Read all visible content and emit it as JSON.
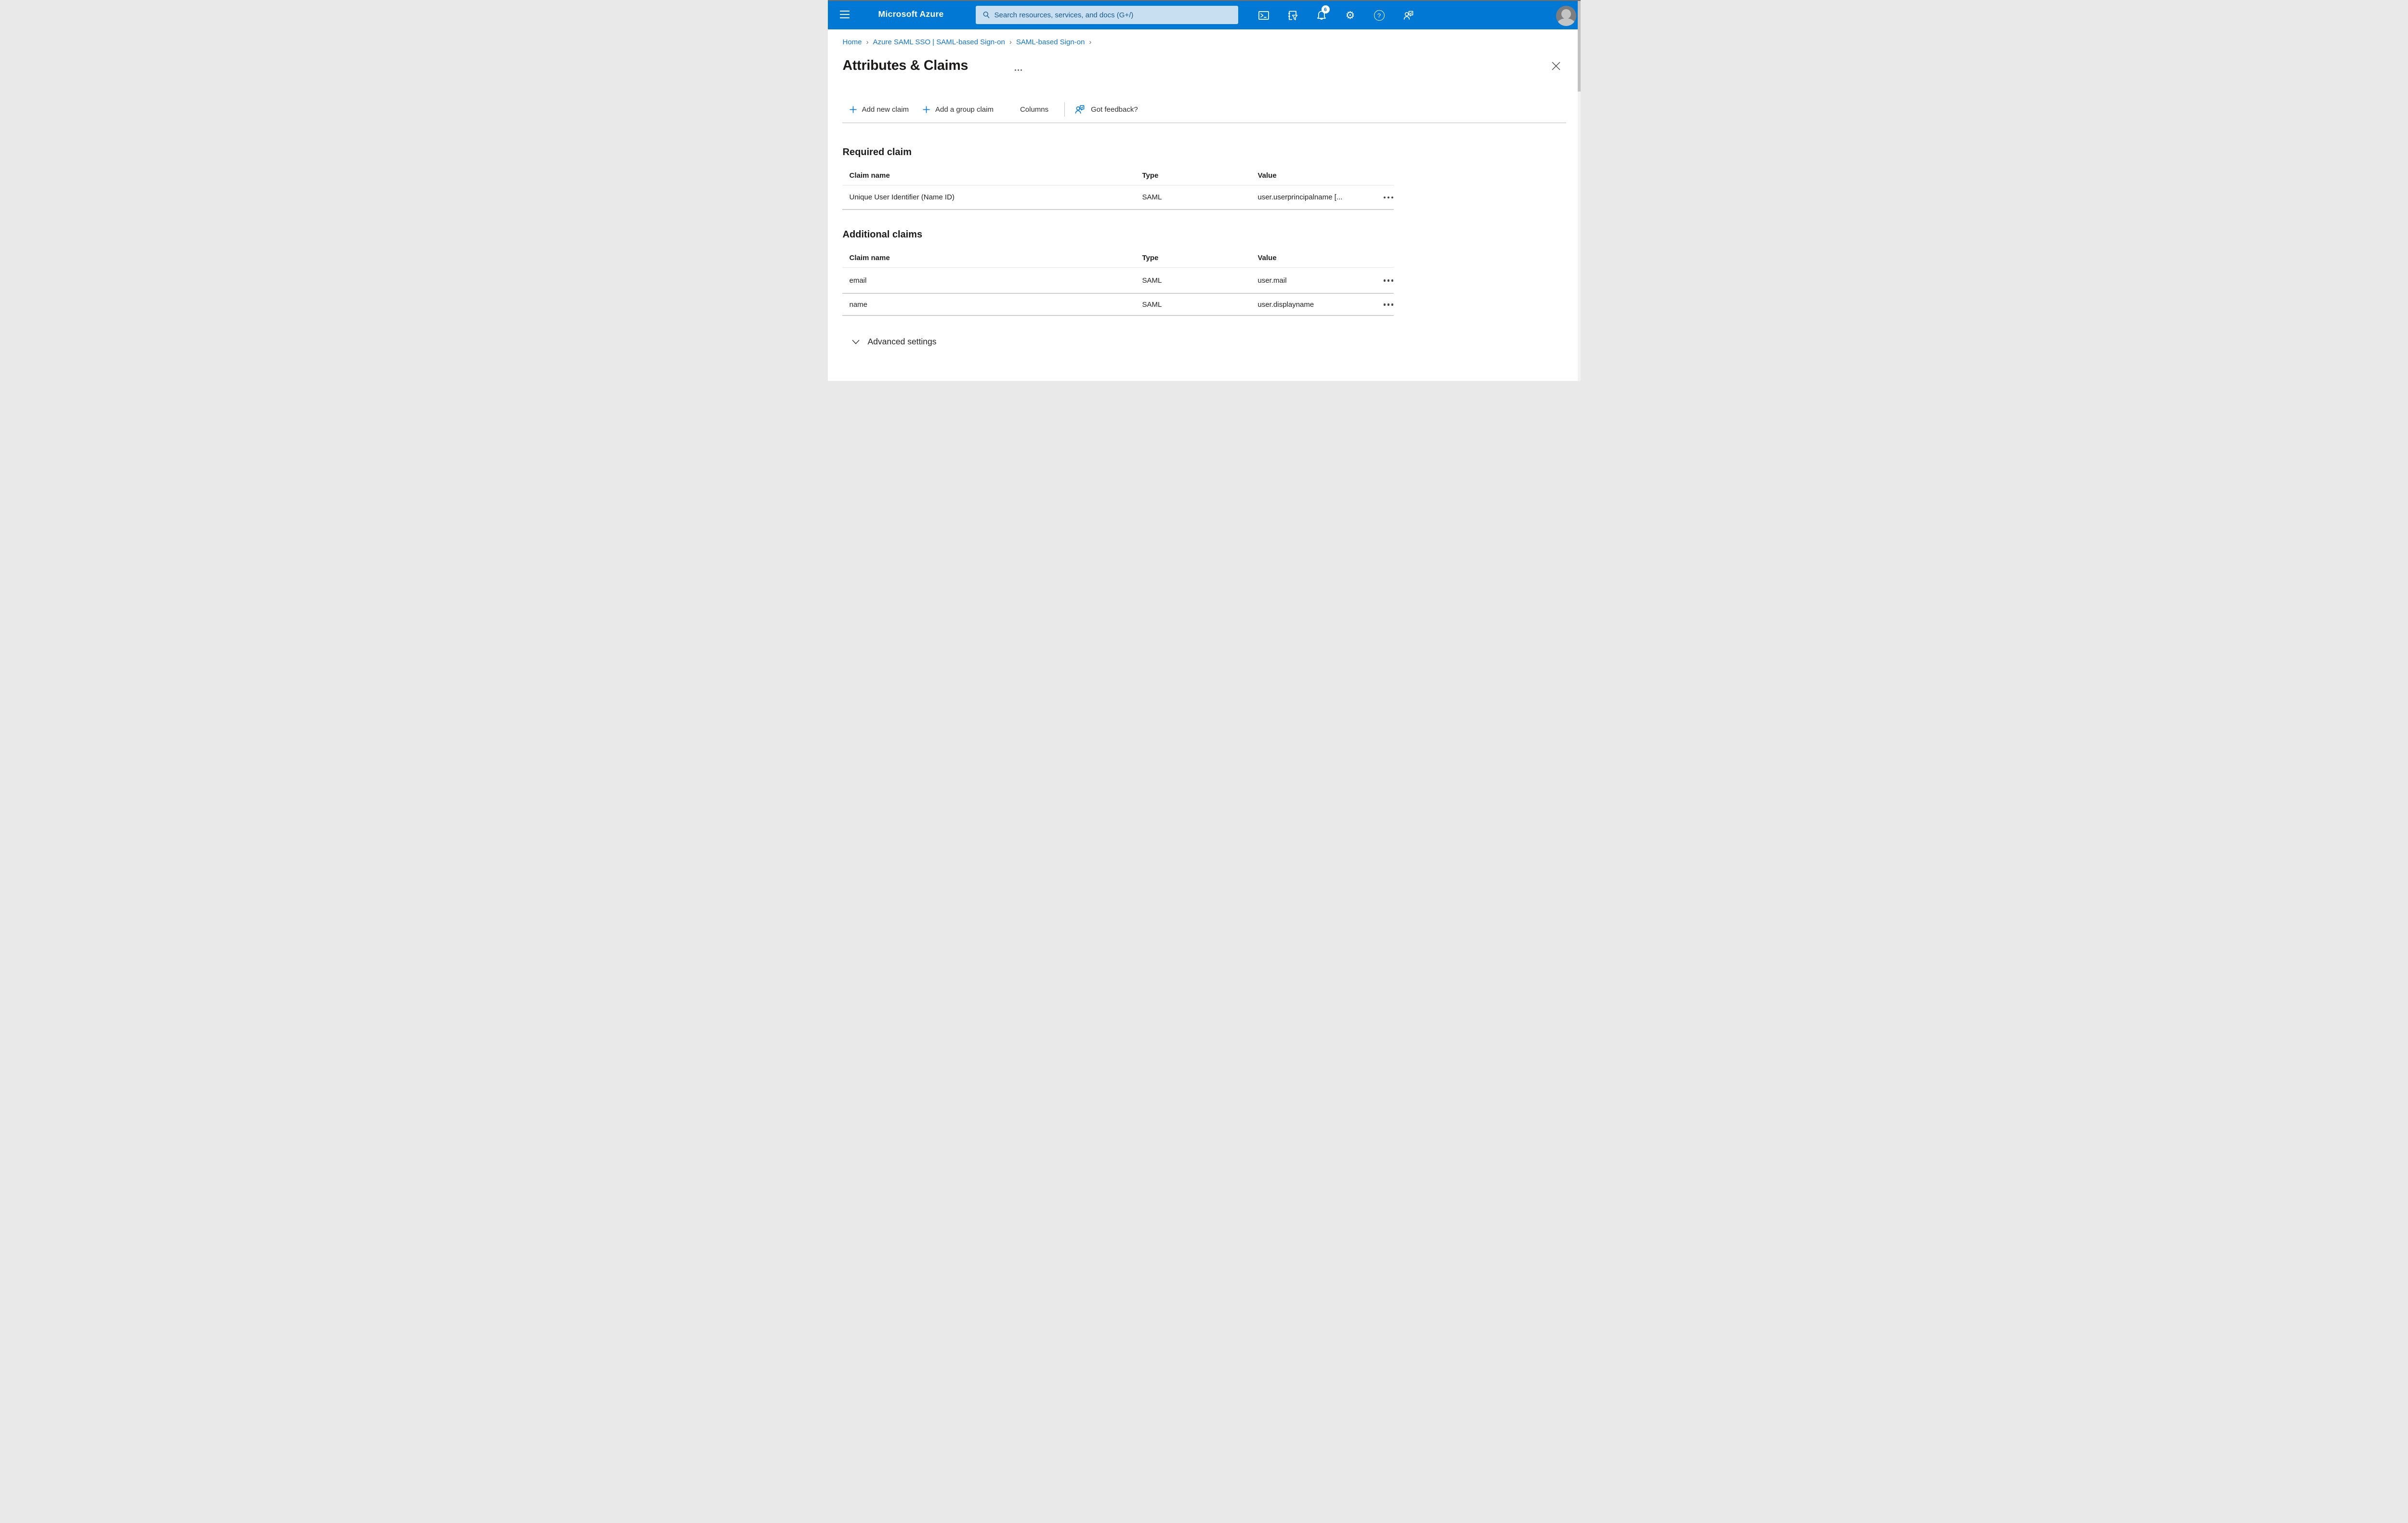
{
  "colors": {
    "topbar_bg": "#0078d4",
    "search_bg": "#c8dff2",
    "search_text": "#15598f",
    "link_blue": "#1374cc",
    "accent_blue": "#0078d4",
    "text_dark": "#201f1e",
    "row_divider": "#d2d0ce"
  },
  "topbar": {
    "brand": "Microsoft Azure",
    "search_placeholder": "Search resources, services, and docs (G+/)",
    "notification_count": "6",
    "icons": [
      "cloud-shell-icon",
      "directory-filter-icon",
      "notifications-bell-icon",
      "settings-gear-icon",
      "help-icon",
      "feedback-icon",
      "avatar"
    ]
  },
  "breadcrumb": {
    "items": [
      "Home",
      "Azure SAML SSO | SAML-based Sign-on",
      "SAML-based Sign-on"
    ]
  },
  "page": {
    "title": "Attributes & Claims"
  },
  "toolbar": {
    "add_new_claim": "Add new claim",
    "add_group_claim": "Add a group claim",
    "columns": "Columns",
    "got_feedback": "Got feedback?"
  },
  "required_claim": {
    "heading": "Required claim",
    "columns": [
      "Claim name",
      "Type",
      "Value"
    ],
    "rows": [
      {
        "claim_name": "Unique User Identifier (Name ID)",
        "type": "SAML",
        "value": "user.userprincipalname [..."
      }
    ]
  },
  "additional_claims": {
    "heading": "Additional claims",
    "columns": [
      "Claim name",
      "Type",
      "Value"
    ],
    "rows": [
      {
        "claim_name": "email",
        "type": "SAML",
        "value": "user.mail"
      },
      {
        "claim_name": "name",
        "type": "SAML",
        "value": "user.displayname"
      }
    ]
  },
  "advanced": {
    "label": "Advanced settings"
  }
}
